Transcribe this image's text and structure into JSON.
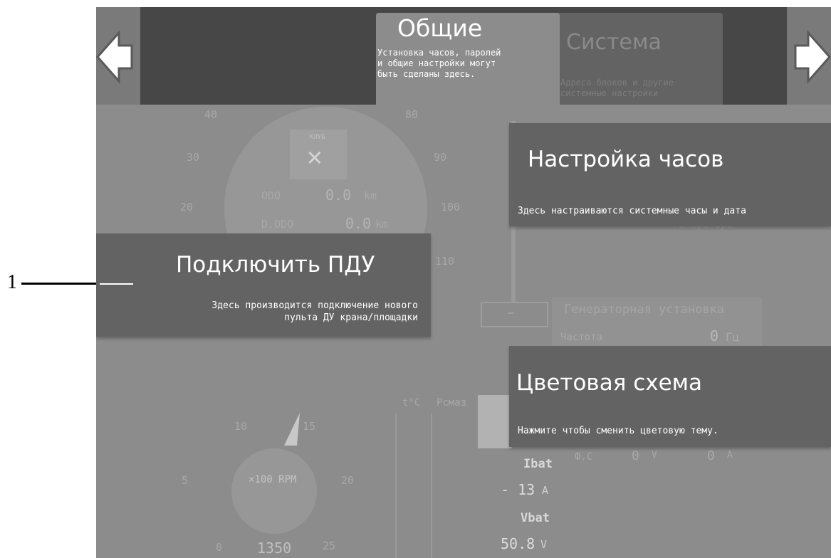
{
  "nav": {
    "prev_icon": "arrow-left-icon",
    "next_icon": "arrow-right-icon"
  },
  "tabs": [
    {
      "title": "Общие",
      "desc": "Установка часов, паролей\nи общие настройки могут\nбыть сделаны здесь."
    },
    {
      "title": "Система",
      "desc": "Адреса блоков и другие\nсистемные настройки"
    }
  ],
  "cards": {
    "clock": {
      "title": "Настройка часов",
      "desc": "Здесь настраиваются системные часы и дата"
    },
    "remote": {
      "title": "Подключить ПДУ",
      "desc": "Здесь производится подключение нового\nпульта ДУ крана/площадки"
    },
    "color": {
      "title": "Цветовая схема",
      "desc": "Нажмите чтобы сменить цветовую тему."
    }
  },
  "callout": {
    "number": "1"
  },
  "background": {
    "speed_ticks": [
      "40",
      "30",
      "20",
      "80",
      "90",
      "100",
      "110"
    ],
    "klub_label": "КЛУБ",
    "odo_label": "ODO",
    "odo_value": "0.0",
    "odo_unit": "km",
    "dodo_label": "D.ODO",
    "dodo_value": "0.0",
    "dodo_unit": "km",
    "generator_partial": "генератора",
    "gen_title": "Генераторная установка",
    "gen_freq_label": "Частота",
    "gen_freq_value": "0",
    "gen_freq_unit": "Гц",
    "phase_label": "Ф.С",
    "phase_v": "0",
    "phase_v_unit": "V",
    "phase_a": "0",
    "phase_a_unit": "A",
    "rpm_ticks": [
      "10",
      "15",
      "5",
      "20",
      "0",
      "25"
    ],
    "rpm_label": "×100 RPM",
    "rpm_value": "1350",
    "temp_label": "t°C",
    "pmas_label": "Pсмаз",
    "ibat_label": "Ibat",
    "ibat_value": "- 13",
    "ibat_unit": "A",
    "vbat_label": "Vbat",
    "vbat_value": "50.8",
    "vbat_unit": "V",
    "minus_button": "—"
  }
}
